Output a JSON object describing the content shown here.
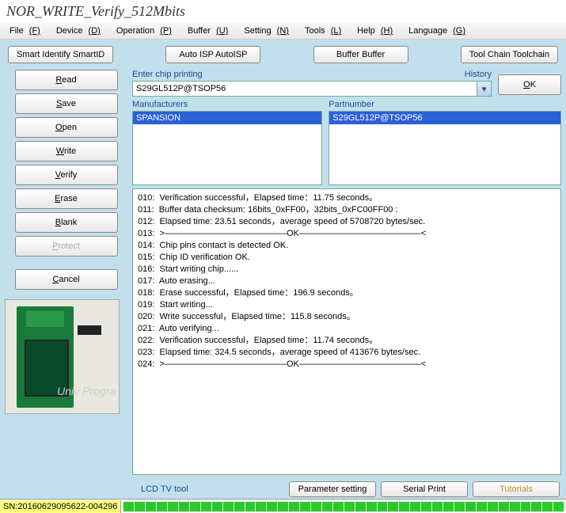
{
  "title": "NOR_WRITE_Verify_512Mbits",
  "menu": {
    "file": "File",
    "device": "Device",
    "operation": "Operation",
    "buffer": "Buffer",
    "setting": "Setting",
    "tools": "Tools",
    "help": "Help",
    "language": "Language",
    "file_k": "(F)",
    "device_k": "(D)",
    "operation_k": "(P)",
    "buffer_k": "(U)",
    "setting_k": "(N)",
    "tools_k": "(L)",
    "help_k": "(H)",
    "language_k": "(G)"
  },
  "topbtns": {
    "smartid": "Smart Identify SmartID",
    "autoisp": "Auto ISP AutoISP",
    "buffer": "Buffer Buffer",
    "toolchain": "Tool Chain Toolchain"
  },
  "left": {
    "read": "Read",
    "save": "Save",
    "open": "Open",
    "write": "Write",
    "verify": "Verify",
    "erase": "Erase",
    "blank": "Blank",
    "protect": "Protect",
    "cancel": "Cancel"
  },
  "search": {
    "chip_label": "Enter chip printing",
    "history_label": "History",
    "chip_value": "S29GL512P@TSOP56",
    "ok": "OK"
  },
  "lists": {
    "mfr_label": "Manufacturers",
    "mfr_item": "SPANSION",
    "part_label": "Partnumber",
    "part_item": "S29GL512P@TSOP56"
  },
  "log": [
    "010:  Verification successful，Elapsed time：11.75 seconds。",
    "011:  Buffer data checksum: 16bits_0xFF00，32bits_0xFC00FF00 :",
    "012:  Elapsed time: 23.51 seconds，average speed of 5708720 bytes/sec.",
    "013:  >——————————————OK——————————————<",
    "014:  Chip pins contact is detected OK.",
    "015:  Chip ID verification OK.",
    "016:  Start writing chip......",
    "017:  Auto erasing...",
    "018:  Erase successful，Elapsed time：196.9 seconds。",
    "019:  Start writing...",
    "020:  Write successful，Elapsed time：115.8 seconds。",
    "021:  Auto verifying...",
    "022:  Verification successful，Elapsed time：11.74 seconds。",
    "023:  Elapsed time: 324.5 seconds，average speed of 413676 bytes/sec.",
    "024:  >——————————————OK——————————————<"
  ],
  "bottom": {
    "lcd": "LCD TV tool",
    "param": "Parameter setting",
    "serial": "Serial Print",
    "tut": "Tutorials"
  },
  "sn": "SN:20160629095622-004296",
  "wm": "Univ\nProgra"
}
